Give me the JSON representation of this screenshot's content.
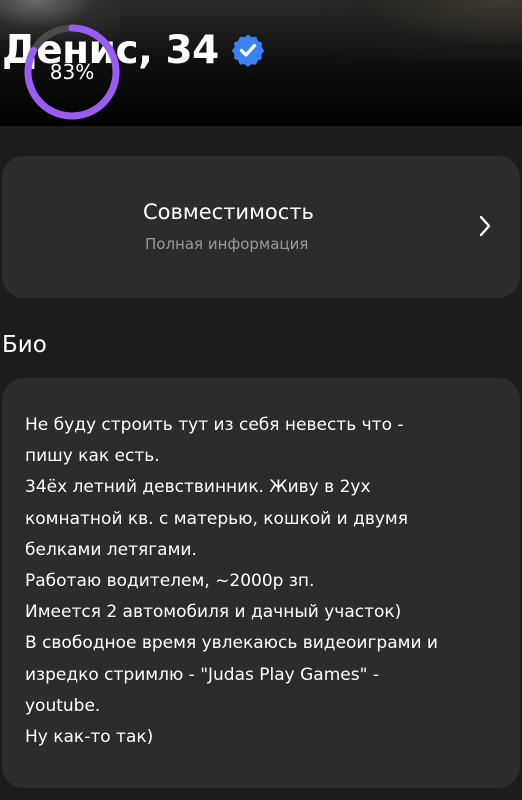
{
  "profile": {
    "name": "Денис, 34",
    "verified_icon": "verified-badge-icon",
    "accent_color": "#3b82f6"
  },
  "compatibility": {
    "percent_label": "83%",
    "percent_value": 0.83,
    "title": "Совместимость",
    "subtitle": "Полная информация",
    "ring_color": "#9b5cf6",
    "chevron_icon": "chevron-right-icon"
  },
  "bio": {
    "label": "Био",
    "lines": [
      "Не буду строить тут из себя невесть что -",
      "пишу как есть.",
      "34ёх летний девствинник. Живу в 2ух",
      "комнатной кв. с матерью, кошкой и двумя",
      "белками летягами.",
      "Работаю водителем, ~2000р зп.",
      "Имеется 2 автомобиля и дачный участок)",
      "В свободное время увлекаюсь видеоиграми и",
      "изредко стримлю - \"Judas Play Games\" -",
      "youtube.",
      "Ну как-то так)"
    ]
  }
}
